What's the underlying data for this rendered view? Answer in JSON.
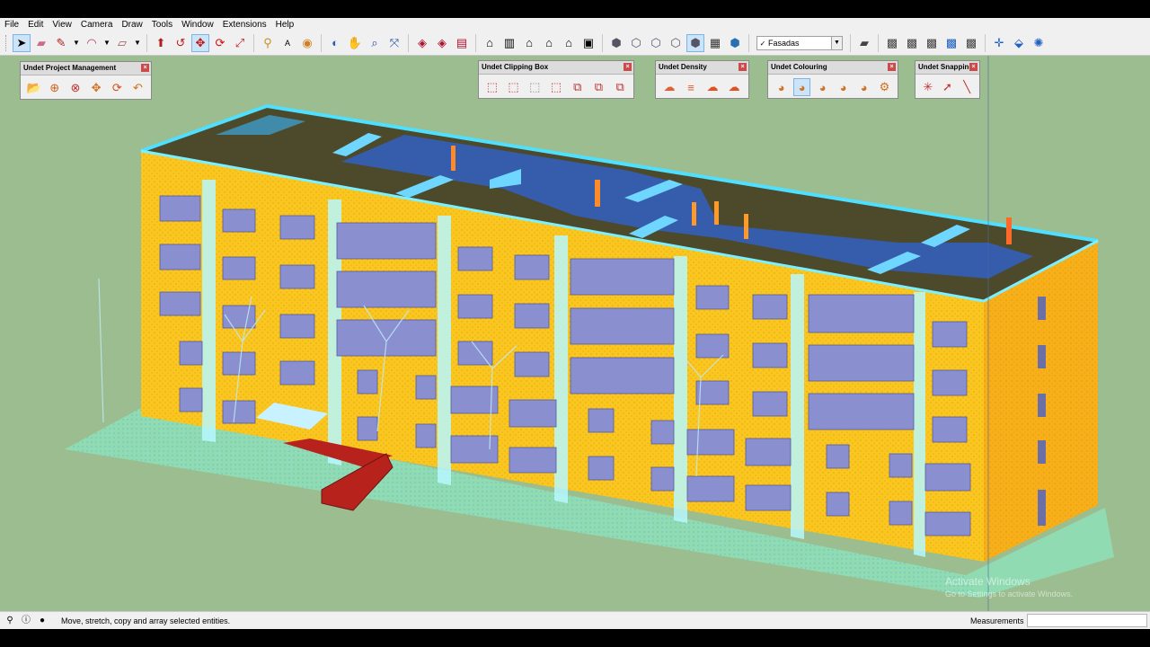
{
  "menu": [
    "File",
    "Edit",
    "View",
    "Camera",
    "Draw",
    "Tools",
    "Window",
    "Extensions",
    "Help"
  ],
  "toolbar": {
    "group1": [
      "select-icon",
      "eraser-icon",
      "pencil-icon",
      "arc-icon",
      "rectangle-icon",
      "push-pull-icon",
      "follow-me-icon",
      "move-icon",
      "rotate-icon",
      "scale-icon"
    ],
    "group2": [
      "tape-measure-icon",
      "text-icon",
      "paint-bucket-icon",
      "orbit-icon",
      "pan-icon",
      "zoom-icon",
      "zoom-extents-icon"
    ],
    "group3": [
      "3d-warehouse-icon",
      "extension-warehouse-icon",
      "layout-icon"
    ],
    "group4": [
      "iso-view-icon",
      "top-view-icon",
      "front-view-icon",
      "right-view-icon",
      "back-view-icon",
      "left-view-icon"
    ],
    "group5": [
      "xray-icon",
      "wireframe-icon",
      "hidden-line-icon",
      "shaded-icon",
      "shaded-textures-icon",
      "monochrome-icon"
    ],
    "scene_selected": "Fasadas",
    "group6": [
      "layer-icon",
      "section-plane-icon",
      "display-section-icon",
      "section-cuts-icon",
      "section-fill-icon",
      "solid-tools-icon"
    ],
    "group7": [
      "axes-icon",
      "position-camera-icon",
      "walk-icon"
    ]
  },
  "panels": {
    "project": {
      "title": "Undet Project Management",
      "icons": [
        "open-project-icon",
        "add-cloud-icon",
        "remove-cloud-icon",
        "move-cloud-icon",
        "refresh-icon",
        "undo-icon"
      ]
    },
    "clipping": {
      "title": "Undet Clipping Box",
      "icons": [
        "clip-box-icon",
        "clip-box-edit-icon",
        "clip-box-hide-icon",
        "clip-box-show-icon",
        "clip-section-1-icon",
        "clip-section-2-icon",
        "clip-section-3-icon"
      ]
    },
    "density": {
      "title": "Undet Density",
      "icons": [
        "cloud-outline-icon",
        "density-gradient-icon",
        "cloud-filled-icon",
        "cloud-settings-icon"
      ]
    },
    "colouring": {
      "title": "Undet Colouring",
      "icons": [
        "rgb-colour-icon",
        "intensity-colour-icon",
        "elevation-colour-icon",
        "classification-colour-icon",
        "normal-colour-icon",
        "colour-settings-icon"
      ]
    },
    "snapping": {
      "title": "Undet Snapping",
      "icons": [
        "snap-point-icon",
        "snap-cursor-icon",
        "snap-line-icon"
      ]
    }
  },
  "viewport": {
    "background": "#9cbd8f"
  },
  "watermark": {
    "line1": "Activate Windows",
    "line2": "Go to Settings to activate Windows."
  },
  "status": {
    "message": "Move, stretch, copy and array selected entities.",
    "measurements_label": "Measurements",
    "measurements_value": ""
  }
}
